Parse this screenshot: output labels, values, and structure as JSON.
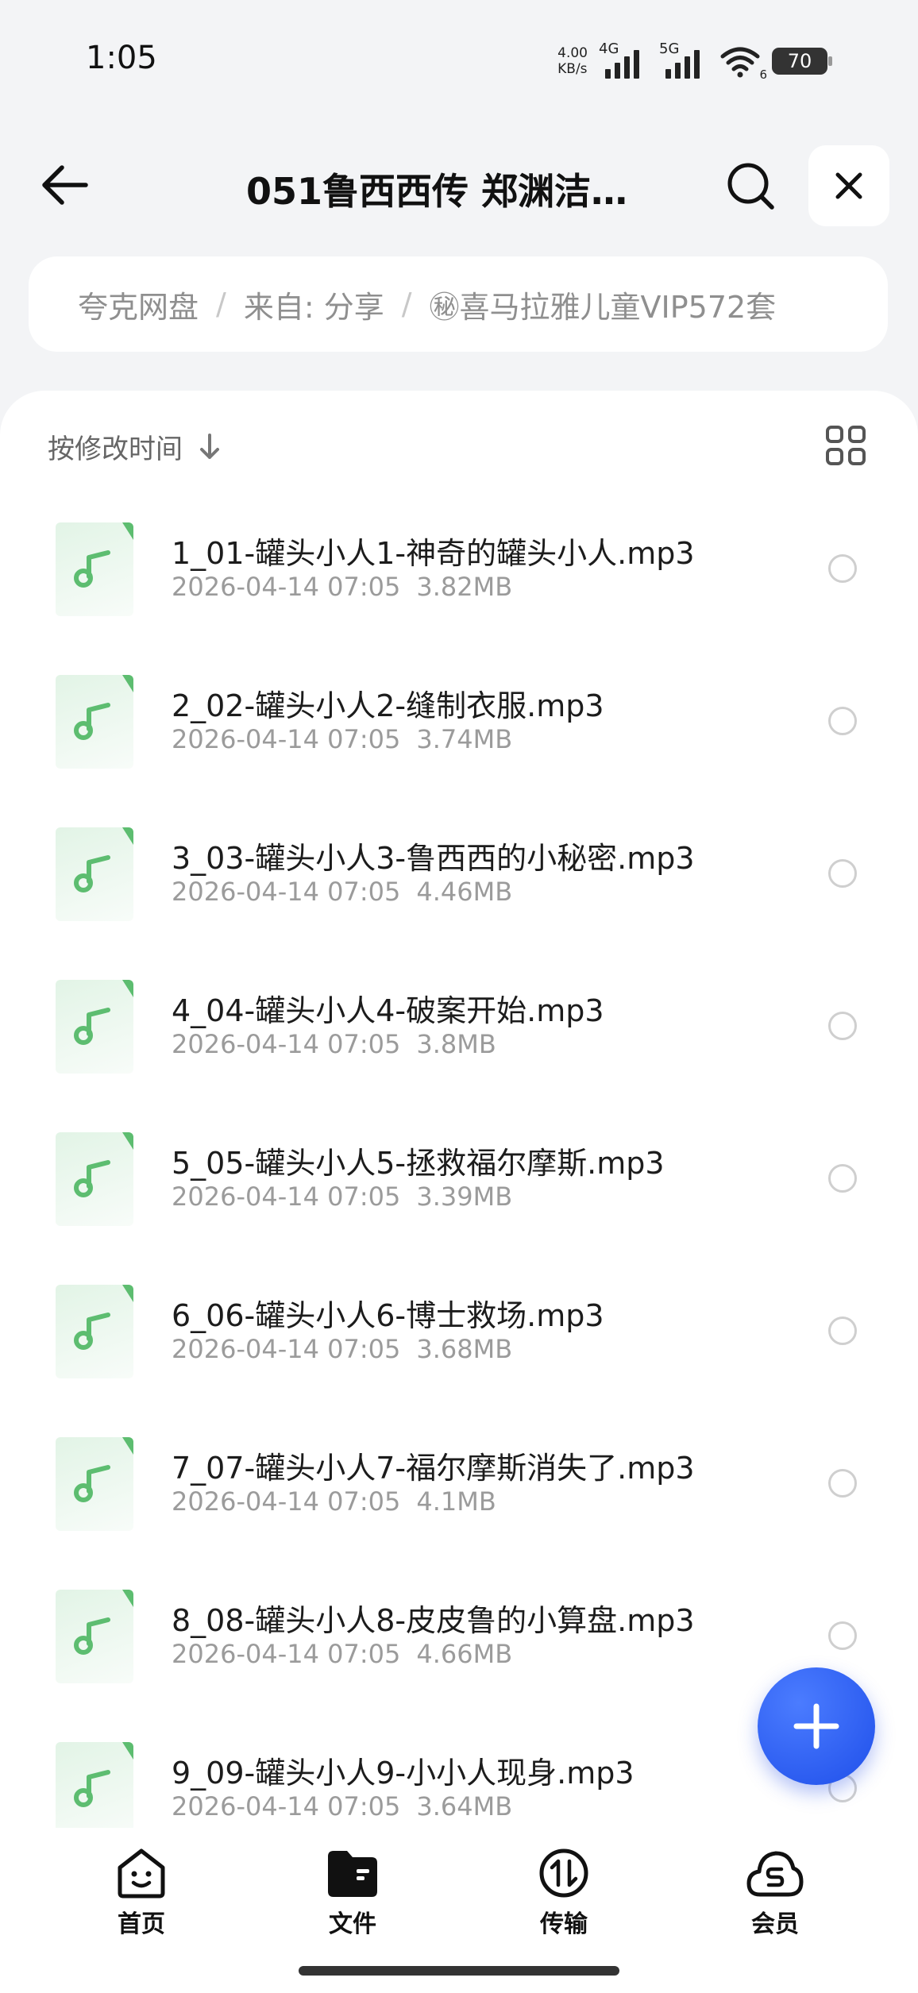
{
  "status": {
    "time": "1:05",
    "net_speed_value": "4.00",
    "net_speed_unit": "KB/s",
    "sim1": "4G",
    "sim2": "5G",
    "wifi_sub": "6",
    "battery": "70"
  },
  "header": {
    "title": "051鲁西西传  郑渊洁…"
  },
  "breadcrumb": {
    "items": [
      "夸克网盘",
      "来自: 分享",
      "㊙喜马拉雅儿童VIP572套"
    ]
  },
  "sort": {
    "label": "按修改时间"
  },
  "files": [
    {
      "name": "1_01-罐头小人1-神奇的罐头小人.mp3",
      "date": "2026-04-14 07:05",
      "size": "3.82MB"
    },
    {
      "name": "2_02-罐头小人2-缝制衣服.mp3",
      "date": "2026-04-14 07:05",
      "size": "3.74MB"
    },
    {
      "name": "3_03-罐头小人3-鲁西西的小秘密.mp3",
      "date": "2026-04-14 07:05",
      "size": "4.46MB"
    },
    {
      "name": "4_04-罐头小人4-破案开始.mp3",
      "date": "2026-04-14 07:05",
      "size": "3.8MB"
    },
    {
      "name": "5_05-罐头小人5-拯救福尔摩斯.mp3",
      "date": "2026-04-14 07:05",
      "size": "3.39MB"
    },
    {
      "name": "6_06-罐头小人6-博士救场.mp3",
      "date": "2026-04-14 07:05",
      "size": "3.68MB"
    },
    {
      "name": "7_07-罐头小人7-福尔摩斯消失了.mp3",
      "date": "2026-04-14 07:05",
      "size": "4.1MB"
    },
    {
      "name": "8_08-罐头小人8-皮皮鲁的小算盘.mp3",
      "date": "2026-04-14 07:05",
      "size": "4.66MB"
    },
    {
      "name": "9_09-罐头小人9-小小人现身.mp3",
      "date": "2026-04-14 07:05",
      "size": "3.64MB"
    }
  ],
  "nav": {
    "home": "首页",
    "files": "文件",
    "transfer": "传输",
    "vip": "会员"
  },
  "colors": {
    "accent": "#1f4fea",
    "music_icon": "#5dbd70"
  }
}
